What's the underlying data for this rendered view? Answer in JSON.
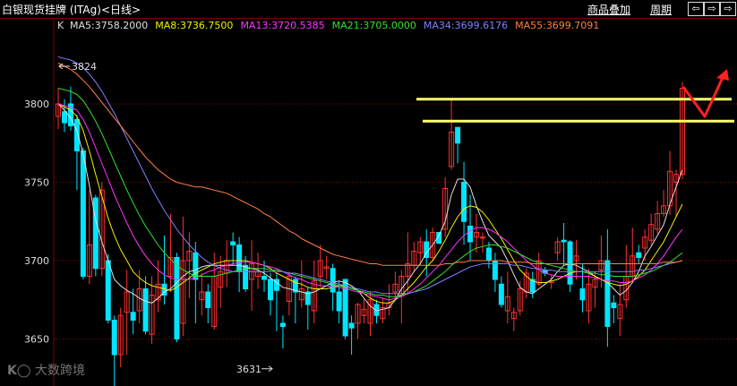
{
  "header": {
    "title": "白银现货挂牌 (ITAg)<日线>",
    "overlay_label": "商品叠加",
    "period_label": "周期",
    "nav_buttons": [
      "⇦",
      "⇨",
      "⇨"
    ]
  },
  "indicator_label": "K",
  "ma_lines": [
    {
      "name": "MA5",
      "value": "3758.2000",
      "color": "#e0e0e0"
    },
    {
      "name": "MA8",
      "value": "3736.7500",
      "color": "#f0f000"
    },
    {
      "name": "MA13",
      "value": "3720.5385",
      "color": "#ff33ff"
    },
    {
      "name": "MA21",
      "value": "3705.0000",
      "color": "#33e033"
    },
    {
      "name": "MA34",
      "value": "3699.6176",
      "color": "#8080ff"
    },
    {
      "name": "MA55",
      "value": "3699.7091",
      "color": "#ff8040"
    }
  ],
  "watermark": "大数跨境",
  "colors": {
    "up": "#ff3030",
    "down": "#00e5ff",
    "grid": "#8a0000",
    "annotation_line": "#ffff66",
    "annotation_arrow": "#ff2020"
  },
  "chart_data": {
    "type": "candlestick",
    "yticks": [
      3650,
      3700,
      3750,
      3800
    ],
    "ylim": [
      3628,
      3842
    ],
    "annotations": {
      "high_label": "3824",
      "low_label": "3631",
      "high": 3824,
      "low": 3631,
      "resistance_levels": [
        3803,
        3789
      ]
    },
    "candles": [
      [
        3792,
        3800,
        3784,
        3810
      ],
      [
        3795,
        3788,
        3782,
        3803
      ],
      [
        3800,
        3786,
        3783,
        3811
      ],
      [
        3790,
        3770,
        3745,
        3793
      ],
      [
        3770,
        3690,
        3688,
        3772
      ],
      [
        3690,
        3710,
        3685,
        3745
      ],
      [
        3740,
        3695,
        3690,
        3742
      ],
      [
        3695,
        3745,
        3690,
        3750
      ],
      [
        3700,
        3662,
        3660,
        3704
      ],
      [
        3662,
        3640,
        3620,
        3665
      ],
      [
        3640,
        3665,
        3632,
        3670
      ],
      [
        3667,
        3680,
        3640,
        3694
      ],
      [
        3667,
        3662,
        3653,
        3682
      ],
      [
        3668,
        3682,
        3660,
        3694
      ],
      [
        3682,
        3655,
        3653,
        3690
      ],
      [
        3653,
        3678,
        3647,
        3690
      ],
      [
        3675,
        3685,
        3667,
        3700
      ],
      [
        3685,
        3678,
        3672,
        3716
      ],
      [
        3690,
        3702,
        3680,
        3730
      ],
      [
        3702,
        3650,
        3648,
        3705
      ],
      [
        3660,
        3700,
        3652,
        3728
      ],
      [
        3700,
        3706,
        3676,
        3718
      ],
      [
        3705,
        3688,
        3660,
        3712
      ],
      [
        3675,
        3680,
        3665,
        3692
      ],
      [
        3680,
        3670,
        3660,
        3685
      ],
      [
        3658,
        3690,
        3656,
        3705
      ],
      [
        3683,
        3693,
        3670,
        3703
      ],
      [
        3692,
        3700,
        3683,
        3713
      ],
      [
        3712,
        3710,
        3697,
        3718
      ],
      [
        3710,
        3693,
        3680,
        3715
      ],
      [
        3697,
        3682,
        3680,
        3703
      ],
      [
        3688,
        3698,
        3668,
        3713
      ],
      [
        3690,
        3693,
        3682,
        3705
      ],
      [
        3690,
        3688,
        3680,
        3700
      ],
      [
        3688,
        3675,
        3665,
        3692
      ],
      [
        3688,
        3681,
        3655,
        3692
      ],
      [
        3660,
        3658,
        3644,
        3665
      ],
      [
        3674,
        3690,
        3665,
        3693
      ],
      [
        3688,
        3680,
        3660,
        3690
      ],
      [
        3675,
        3682,
        3670,
        3700
      ],
      [
        3680,
        3672,
        3656,
        3683
      ],
      [
        3668,
        3687,
        3660,
        3700
      ],
      [
        3690,
        3700,
        3683,
        3710
      ],
      [
        3695,
        3696,
        3688,
        3703
      ],
      [
        3695,
        3680,
        3668,
        3698
      ],
      [
        3680,
        3668,
        3660,
        3687
      ],
      [
        3688,
        3652,
        3650,
        3688
      ],
      [
        3660,
        3657,
        3640,
        3665
      ],
      [
        3660,
        3672,
        3650,
        3673
      ],
      [
        3665,
        3669,
        3660,
        3676
      ],
      [
        3660,
        3675,
        3652,
        3680
      ],
      [
        3672,
        3665,
        3660,
        3675
      ],
      [
        3663,
        3670,
        3660,
        3676
      ],
      [
        3670,
        3673,
        3665,
        3685
      ],
      [
        3680,
        3685,
        3675,
        3693
      ],
      [
        3678,
        3690,
        3660,
        3694
      ],
      [
        3690,
        3698,
        3678,
        3718
      ],
      [
        3697,
        3706,
        3693,
        3712
      ],
      [
        3705,
        3712,
        3697,
        3715
      ],
      [
        3712,
        3702,
        3690,
        3720
      ],
      [
        3702,
        3718,
        3700,
        3721
      ],
      [
        3718,
        3711,
        3710,
        3710
      ],
      [
        3720,
        3746,
        3715,
        3753
      ],
      [
        3760,
        3782,
        3758,
        3803
      ],
      [
        3785,
        3775,
        3762,
        3785
      ],
      [
        3750,
        3725,
        3710,
        3763
      ],
      [
        3722,
        3712,
        3700,
        3742
      ],
      [
        3715,
        3718,
        3705,
        3730
      ],
      [
        3715,
        3715,
        3705,
        3718
      ],
      [
        3708,
        3700,
        3695,
        3712
      ],
      [
        3700,
        3688,
        3680,
        3705
      ],
      [
        3685,
        3672,
        3670,
        3690
      ],
      [
        3668,
        3677,
        3660,
        3693
      ],
      [
        3663,
        3667,
        3655,
        3670
      ],
      [
        3668,
        3682,
        3665,
        3687
      ],
      [
        3680,
        3692,
        3676,
        3695
      ],
      [
        3688,
        3680,
        3676,
        3693
      ],
      [
        3685,
        3700,
        3684,
        3705
      ],
      [
        3694,
        3692,
        3690,
        3696
      ],
      [
        3686,
        3687,
        3682,
        3691
      ],
      [
        3705,
        3712,
        3700,
        3715
      ],
      [
        3713,
        3712,
        3697,
        3724
      ],
      [
        3712,
        3685,
        3680,
        3713
      ],
      [
        3700,
        3703,
        3688,
        3713
      ],
      [
        3682,
        3675,
        3667,
        3698
      ],
      [
        3668,
        3685,
        3660,
        3695
      ],
      [
        3683,
        3688,
        3670,
        3693
      ],
      [
        3694,
        3700,
        3683,
        3716
      ],
      [
        3700,
        3658,
        3645,
        3720
      ],
      [
        3673,
        3670,
        3660,
        3678
      ],
      [
        3663,
        3672,
        3652,
        3685
      ],
      [
        3675,
        3690,
        3670,
        3710
      ],
      [
        3690,
        3703,
        3686,
        3721
      ],
      [
        3705,
        3702,
        3698,
        3710
      ],
      [
        3708,
        3715,
        3700,
        3720
      ],
      [
        3713,
        3723,
        3710,
        3730
      ],
      [
        3720,
        3730,
        3717,
        3738
      ],
      [
        3730,
        3735,
        3728,
        3745
      ],
      [
        3735,
        3757,
        3729,
        3770
      ],
      [
        3750,
        3755,
        3728,
        3758
      ],
      [
        3755,
        3810,
        3752,
        3814
      ]
    ],
    "ma": {
      "MA5": [
        3800,
        3796,
        3791,
        3783,
        3768,
        3748,
        3726,
        3712,
        3700,
        3688,
        3684,
        3681,
        3679,
        3676,
        3674,
        3673,
        3676,
        3680,
        3682,
        3686,
        3690,
        3693,
        3694,
        3696,
        3697,
        3697,
        3697,
        3697,
        3697,
        3697,
        3696,
        3695,
        3694,
        3692,
        3689,
        3686,
        3683,
        3682,
        3681,
        3680,
        3679,
        3680,
        3682,
        3684,
        3686,
        3687,
        3686,
        3684,
        3681,
        3676,
        3671,
        3668,
        3669,
        3670,
        3675,
        3682,
        3687,
        3693,
        3698,
        3705,
        3710,
        3716,
        3725,
        3742,
        3752,
        3752,
        3747,
        3735,
        3725,
        3716,
        3712,
        3708,
        3700,
        3691,
        3683,
        3680,
        3679,
        3682,
        3685,
        3688,
        3693,
        3697,
        3698,
        3697,
        3695,
        3693,
        3690,
        3688,
        3686,
        3682,
        3678,
        3681,
        3686,
        3693,
        3703,
        3709,
        3716,
        3723,
        3736,
        3747,
        3758
      ],
      "MA8": [
        3800,
        3798,
        3796,
        3792,
        3783,
        3770,
        3755,
        3741,
        3727,
        3716,
        3707,
        3700,
        3693,
        3689,
        3686,
        3684,
        3683,
        3682,
        3681,
        3683,
        3686,
        3689,
        3692,
        3694,
        3696,
        3698,
        3699,
        3700,
        3700,
        3700,
        3700,
        3699,
        3698,
        3697,
        3695,
        3692,
        3690,
        3688,
        3686,
        3685,
        3683,
        3682,
        3682,
        3682,
        3683,
        3684,
        3684,
        3683,
        3681,
        3679,
        3676,
        3674,
        3673,
        3673,
        3675,
        3678,
        3682,
        3686,
        3691,
        3696,
        3700,
        3706,
        3713,
        3721,
        3728,
        3733,
        3735,
        3734,
        3731,
        3726,
        3720,
        3714,
        3707,
        3700,
        3694,
        3690,
        3687,
        3686,
        3686,
        3687,
        3688,
        3690,
        3692,
        3693,
        3693,
        3692,
        3690,
        3688,
        3686,
        3685,
        3684,
        3685,
        3687,
        3690,
        3694,
        3700,
        3706,
        3712,
        3720,
        3728,
        3736
      ],
      "MA13": [
        3800,
        3799,
        3798,
        3796,
        3790,
        3782,
        3772,
        3762,
        3752,
        3742,
        3733,
        3724,
        3716,
        3709,
        3703,
        3698,
        3694,
        3691,
        3689,
        3688,
        3688,
        3688,
        3689,
        3691,
        3693,
        3694,
        3696,
        3697,
        3698,
        3699,
        3699,
        3699,
        3698,
        3697,
        3696,
        3695,
        3693,
        3691,
        3689,
        3688,
        3686,
        3685,
        3684,
        3684,
        3683,
        3683,
        3682,
        3681,
        3680,
        3679,
        3678,
        3677,
        3676,
        3675,
        3676,
        3677,
        3679,
        3682,
        3685,
        3689,
        3693,
        3697,
        3702,
        3707,
        3712,
        3716,
        3719,
        3721,
        3721,
        3720,
        3718,
        3715,
        3712,
        3708,
        3704,
        3700,
        3697,
        3694,
        3692,
        3691,
        3690,
        3690,
        3690,
        3690,
        3690,
        3690,
        3689,
        3688,
        3687,
        3687,
        3686,
        3686,
        3687,
        3689,
        3691,
        3694,
        3698,
        3703,
        3709,
        3715,
        3720
      ],
      "MA21": [
        3810,
        3809,
        3808,
        3806,
        3802,
        3796,
        3789,
        3781,
        3772,
        3763,
        3754,
        3745,
        3737,
        3729,
        3722,
        3716,
        3710,
        3705,
        3701,
        3697,
        3694,
        3692,
        3690,
        3690,
        3690,
        3690,
        3691,
        3692,
        3693,
        3694,
        3695,
        3695,
        3695,
        3695,
        3694,
        3694,
        3693,
        3692,
        3691,
        3690,
        3689,
        3688,
        3687,
        3686,
        3685,
        3684,
        3683,
        3682,
        3681,
        3680,
        3679,
        3678,
        3678,
        3677,
        3677,
        3678,
        3679,
        3680,
        3682,
        3684,
        3687,
        3690,
        3693,
        3697,
        3700,
        3703,
        3706,
        3708,
        3709,
        3710,
        3710,
        3709,
        3708,
        3706,
        3704,
        3702,
        3700,
        3699,
        3698,
        3697,
        3696,
        3695,
        3694,
        3693,
        3693,
        3692,
        3692,
        3691,
        3691,
        3690,
        3690,
        3690,
        3690,
        3691,
        3692,
        3693,
        3695,
        3697,
        3699,
        3702,
        3705
      ],
      "MA34": [
        3830,
        3829,
        3828,
        3826,
        3823,
        3819,
        3814,
        3808,
        3801,
        3794,
        3786,
        3778,
        3770,
        3762,
        3754,
        3746,
        3739,
        3732,
        3726,
        3720,
        3715,
        3710,
        3706,
        3702,
        3699,
        3697,
        3695,
        3694,
        3693,
        3693,
        3693,
        3693,
        3693,
        3693,
        3693,
        3693,
        3693,
        3692,
        3692,
        3691,
        3690,
        3689,
        3688,
        3687,
        3686,
        3685,
        3684,
        3683,
        3682,
        3681,
        3680,
        3680,
        3679,
        3679,
        3679,
        3679,
        3679,
        3680,
        3681,
        3682,
        3684,
        3686,
        3688,
        3690,
        3692,
        3694,
        3696,
        3697,
        3698,
        3698,
        3698,
        3698,
        3698,
        3697,
        3697,
        3696,
        3695,
        3695,
        3694,
        3694,
        3693,
        3693,
        3693,
        3693,
        3693,
        3693,
        3693,
        3693,
        3693,
        3693,
        3693,
        3693,
        3693,
        3694,
        3694,
        3695,
        3696,
        3697,
        3698,
        3699,
        3700
      ],
      "MA55": [
        3826,
        3824,
        3822,
        3819,
        3815,
        3811,
        3806,
        3801,
        3796,
        3791,
        3786,
        3781,
        3776,
        3771,
        3766,
        3762,
        3758,
        3755,
        3752,
        3750,
        3749,
        3748,
        3747,
        3747,
        3746,
        3745,
        3744,
        3743,
        3741,
        3739,
        3737,
        3735,
        3733,
        3730,
        3728,
        3725,
        3722,
        3719,
        3717,
        3714,
        3712,
        3710,
        3708,
        3706,
        3704,
        3703,
        3702,
        3701,
        3700,
        3699,
        3698,
        3698,
        3697,
        3697,
        3697,
        3697,
        3697,
        3697,
        3697,
        3697,
        3697,
        3697,
        3698,
        3698,
        3699,
        3699,
        3700,
        3700,
        3700,
        3700,
        3700,
        3700,
        3699,
        3699,
        3699,
        3699,
        3698,
        3698,
        3698,
        3698,
        3698,
        3698,
        3698,
        3698,
        3698,
        3698,
        3698,
        3698,
        3698,
        3698,
        3698,
        3698,
        3698,
        3698,
        3698,
        3698,
        3698,
        3699,
        3699,
        3699,
        3700
      ]
    }
  }
}
